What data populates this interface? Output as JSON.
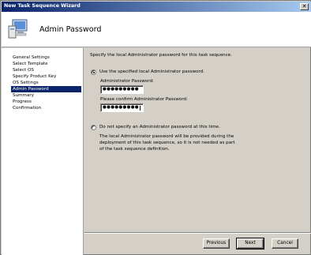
{
  "window": {
    "title": "New Task Sequence Wizard",
    "close_glyph": "✕"
  },
  "header": {
    "title": "Admin Password",
    "icon": "computer-icon"
  },
  "nav": {
    "items": [
      {
        "label": "General Settings"
      },
      {
        "label": "Select Template"
      },
      {
        "label": "Select OS"
      },
      {
        "label": "Specify Product Key"
      },
      {
        "label": "OS Settings"
      },
      {
        "label": "Admin Password"
      },
      {
        "label": "Summary"
      },
      {
        "label": "Progress"
      },
      {
        "label": "Confirmation"
      }
    ],
    "active_index": 5
  },
  "content": {
    "intro": "Specify the local Administrator password for this task sequence.",
    "option_use": "Use the specified local Administrator password.",
    "admin_password_label": "Administrator Password:",
    "admin_password_value": "●●●●●●●●●",
    "confirm_password_label": "Please confirm Administrator Password:",
    "confirm_password_value": "●●●●●●●●●",
    "option_none": "Do not specify an Administrator password at this time.",
    "note": "The local Administrator password will be provided during the deployment of this task sequence, so it is not needed as part of the task sequence definition."
  },
  "buttons": {
    "previous": "Previous",
    "next": "Next",
    "cancel": "Cancel"
  }
}
